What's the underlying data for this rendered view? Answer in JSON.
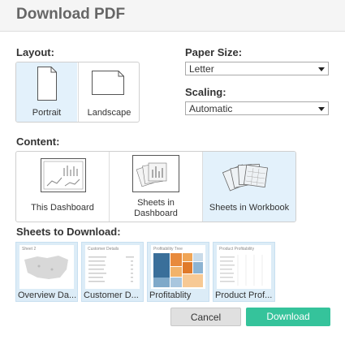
{
  "dialog": {
    "title": "Download PDF"
  },
  "layout": {
    "label": "Layout:",
    "options": [
      {
        "label": "Portrait",
        "selected": true
      },
      {
        "label": "Landscape",
        "selected": false
      }
    ]
  },
  "paper_size": {
    "label": "Paper Size:",
    "value": "Letter"
  },
  "scaling": {
    "label": "Scaling:",
    "value": "Automatic"
  },
  "content": {
    "label": "Content:",
    "options": [
      {
        "label": "This Dashboard",
        "selected": false
      },
      {
        "label_line1": "Sheets in",
        "label_line2": "Dashboard",
        "selected": false
      },
      {
        "label": "Sheets in Workbook",
        "selected": true
      }
    ]
  },
  "sheets": {
    "label": "Sheets to Download:",
    "items": [
      {
        "label": "Overview Da...",
        "inner_title": "Sheet 2"
      },
      {
        "label": "Customer D...",
        "inner_title": "Customer Details"
      },
      {
        "label": "Profitablity",
        "inner_title": "Profitability Tree"
      },
      {
        "label": "Product Prof...",
        "inner_title": "Product Profitability"
      }
    ]
  },
  "buttons": {
    "cancel": "Cancel",
    "download": "Download"
  },
  "colors": {
    "accent": "#35c39b",
    "selected_bg": "#e3f1fb",
    "thumb_bg": "#dcecf7"
  }
}
